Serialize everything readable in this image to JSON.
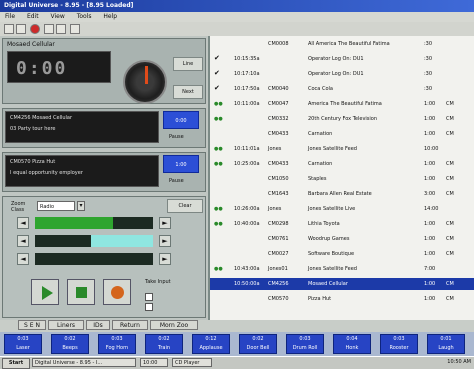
{
  "window": {
    "title": "Digital Universe - 8.95 - [8.95 Loaded]"
  },
  "menu": [
    "File",
    "Edit",
    "View",
    "Tools",
    "Help"
  ],
  "onair": {
    "label": "Mosaed Cellular",
    "time": "0:00",
    "buttons": {
      "line": "Line",
      "next": "Next"
    }
  },
  "decks": [
    {
      "id": "deck-1",
      "line1": "CM4256  Mosaed Cellular",
      "line2": "03  Party tour here",
      "time": "0:00",
      "pause": "Pause"
    },
    {
      "id": "deck-2",
      "line1": "CM0570  Pizza Hut",
      "line2": "I  equal opportunity employer",
      "time": "1:00",
      "pause": "Pause"
    }
  ],
  "zoom": {
    "label": "Zoom Class",
    "value": "Radio",
    "clear": "Clear"
  },
  "take_input": {
    "label": "Take Input"
  },
  "tabs": [
    "S E N",
    "Liners",
    "IDs",
    "Return",
    "Morn Zoo"
  ],
  "log": [
    {
      "icon": "",
      "time": "",
      "code": "CM0008",
      "title": "All America The Beautiful Fatima",
      "len": ":30",
      "cat": "",
      "sel": false
    },
    {
      "icon": "check",
      "time": "10:15:35a",
      "code": "",
      "title": "Operator Log On: DU1",
      "len": ":30",
      "cat": "",
      "sel": false
    },
    {
      "icon": "check",
      "time": "10:17:10a",
      "code": "",
      "title": "Operator Log On: DU1",
      "len": ":30",
      "cat": "",
      "sel": false
    },
    {
      "icon": "check",
      "time": "10:17:50a",
      "code": "CM0040",
      "title": "Coca Cola",
      "len": ":30",
      "cat": "",
      "sel": false
    },
    {
      "icon": "dots",
      "time": "10:11:00a",
      "code": "CM0047",
      "title": "America The Beautiful Fatima",
      "len": "1:00",
      "cat": "CM",
      "sel": false
    },
    {
      "icon": "dots",
      "time": "",
      "code": "CM0332",
      "title": "20th Century Fox Television",
      "len": "1:00",
      "cat": "CM",
      "sel": false
    },
    {
      "icon": "",
      "time": "",
      "code": "CM0433",
      "title": "Carnation",
      "len": "1:00",
      "cat": "CM",
      "sel": false
    },
    {
      "icon": "dots",
      "time": "10:11:01a",
      "code": "Jones",
      "title": "Jones Satellite Feed",
      "len": "10:00",
      "cat": "",
      "sel": false
    },
    {
      "icon": "dots",
      "time": "10:25:00a",
      "code": "CM0433",
      "title": "Carnation",
      "len": "1:00",
      "cat": "CM",
      "sel": false
    },
    {
      "icon": "",
      "time": "",
      "code": "CM1050",
      "title": "Staples",
      "len": "1:00",
      "cat": "CM",
      "sel": false
    },
    {
      "icon": "",
      "time": "",
      "code": "CM1643",
      "title": "Barbara Allen Real Estate",
      "len": "3:00",
      "cat": "CM",
      "sel": false
    },
    {
      "icon": "dots",
      "time": "10:26:00a",
      "code": "Jones",
      "title": "Jones Satellite Live",
      "len": "14:00",
      "cat": "",
      "sel": false
    },
    {
      "icon": "dots",
      "time": "10:40:00a",
      "code": "CM0298",
      "title": "Lithia Toyota",
      "len": "1:00",
      "cat": "CM",
      "sel": false
    },
    {
      "icon": "",
      "time": "",
      "code": "CM0761",
      "title": "Woodrup Games",
      "len": "1:00",
      "cat": "CM",
      "sel": false
    },
    {
      "icon": "",
      "time": "",
      "code": "CM0027",
      "title": "Software Boutique",
      "len": "1:00",
      "cat": "CM",
      "sel": false
    },
    {
      "icon": "dots",
      "time": "10:43:00a",
      "code": "Jones01",
      "title": "Jones Satellite Feed",
      "len": "7:00",
      "cat": "",
      "sel": false
    },
    {
      "icon": "",
      "time": "10:50:00a",
      "code": "CM4256",
      "title": "Mosaed Cellular",
      "len": "1:00",
      "cat": "CM",
      "sel": true
    },
    {
      "icon": "",
      "time": "",
      "code": "CM0570",
      "title": "Pizza Hut",
      "len": "1:00",
      "cat": "CM",
      "sel": false
    }
  ],
  "carts": [
    {
      "top": "0:03",
      "label": "Laser"
    },
    {
      "top": "0:02",
      "label": "Beeps"
    },
    {
      "top": "0:03",
      "label": "Fog Horn"
    },
    {
      "top": "0:02",
      "label": "Train"
    },
    {
      "top": "0:12",
      "label": "Applause"
    },
    {
      "top": "0:02",
      "label": "Door Bell"
    },
    {
      "top": "0:03",
      "label": "Drum Roll"
    },
    {
      "top": "0:04",
      "label": "Honk"
    },
    {
      "top": "0:03",
      "label": "Rooster"
    },
    {
      "top": "0:01",
      "label": "Laugh"
    }
  ],
  "taskbar": {
    "start": "Start",
    "task1": "Digital Universe - 8.95 - I...",
    "task2": "CD Player",
    "status": "10:00",
    "clock": "10:50 AM"
  },
  "colors": {
    "title": "#1b3a9c",
    "cart": "#2744c4",
    "selection": "#1c3aa8",
    "fader_green": "#2fa52f",
    "fader_cyan": "#8fe6e0"
  }
}
